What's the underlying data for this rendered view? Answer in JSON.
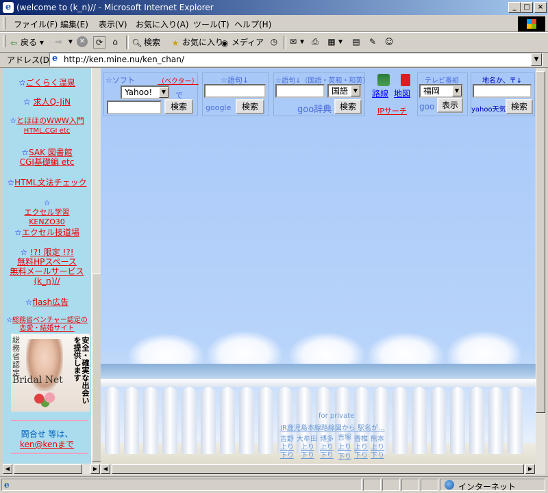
{
  "window": {
    "title": "(welcome to (k_n)// - Microsoft Internet Explorer",
    "minimize": "_",
    "maximize": "□",
    "close": "×"
  },
  "menu": [
    "ファイル(F)",
    "編集(E)",
    "表示(V)",
    "お気に入り(A)",
    "ツール(T)",
    "ヘルプ(H)"
  ],
  "toolbar": {
    "back": "戻る",
    "search": "検索",
    "favorites": "お気に入り",
    "media": "メディア"
  },
  "address": {
    "label": "アドレス(D)",
    "url": "http://ken.mine.nu/ken_chan/"
  },
  "sidebar": {
    "star": "☆",
    "links": [
      {
        "text": "ごくらく温泉"
      },
      {
        "text": "求人Q-JiN"
      },
      {
        "text": "とほほのWWW入門",
        "sub": "HTML,CGI etc"
      },
      {
        "text": "SAK 図書館",
        "sub": "CGI基礎編 etc"
      },
      {
        "text": "HTML文法チェック"
      },
      {
        "text": "エクセル学習",
        "sub": "KENZO30"
      },
      {
        "text": "エクセル技道場"
      },
      {
        "text": "!?! 限定 !?!",
        "sub": "無料HPスペース",
        "sub2": "無料メールサービス",
        "sub3": "(k_n)//"
      },
      {
        "text": "flash広告"
      },
      {
        "text": "総務省ベンチャー認定の",
        "sub": "恋愛・結婚サイト"
      }
    ],
    "banner": {
      "left": "総務省認定",
      "right": "安全・確実な出会いを提供します",
      "brand": "Bridal Net"
    },
    "contact": {
      "line1": "問合せ 等は、",
      "line2": "ken@kenまで"
    }
  },
  "search": {
    "soft": {
      "label": "☆ソフト",
      "vector": "（ベクター）",
      "select": "Yahoo!",
      "de": "で",
      "button": "検索"
    },
    "google": {
      "label": "☆語句↓",
      "brand": "google",
      "button": "検索"
    },
    "goo": {
      "label": "☆語句↓（国語・英和・和英）",
      "select": "国語",
      "brand": "goo辞典",
      "button": "検索",
      "ip": "IPサーチ"
    },
    "route": {
      "label": "路線",
      "map": "地図"
    },
    "tv": {
      "label": "テレビ番組",
      "select": "福岡",
      "brand": "goo",
      "button": "表示"
    },
    "weather": {
      "label": "地名か、〒↓",
      "brand": "yahoo天気",
      "button": "検索"
    }
  },
  "footer": {
    "private": "for private",
    "line1": "JR鹿児島本線路線図から 駅名が...",
    "stations": [
      "吉野",
      "大牟田",
      "博多",
      "吉塚",
      "香椎",
      "熊本"
    ],
    "up": "上り",
    "down": "下り"
  },
  "status": {
    "zone": "インターネット"
  }
}
